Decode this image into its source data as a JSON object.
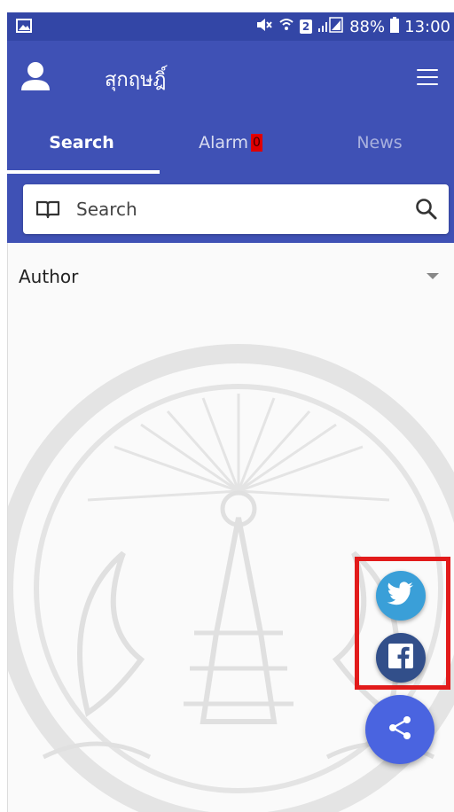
{
  "status_bar": {
    "battery": "88%",
    "time": "13:00",
    "sim_slot": "2"
  },
  "app_bar": {
    "title": "สุกฤษฎิ์",
    "account_icon": "person-icon",
    "menu_icon": "hamburger-menu-icon"
  },
  "tabs": [
    {
      "label": "Search",
      "active": true
    },
    {
      "label": "Alarm",
      "badge": "0"
    },
    {
      "label": "News"
    }
  ],
  "search": {
    "placeholder": "Search",
    "left_icon": "book-icon",
    "right_icon": "search-icon"
  },
  "filter": {
    "label": "Author"
  },
  "fabs": {
    "twitter_icon": "twitter-icon",
    "facebook_icon": "facebook-icon",
    "share_icon": "share-icon"
  },
  "colors": {
    "primary": "#3f51b5",
    "status_bar": "#3346a6",
    "highlight": "#e21b1b",
    "badge": "#e00000",
    "twitter": "#3a9fd8",
    "facebook": "#324f8a",
    "share_fab": "#4a64e0"
  }
}
